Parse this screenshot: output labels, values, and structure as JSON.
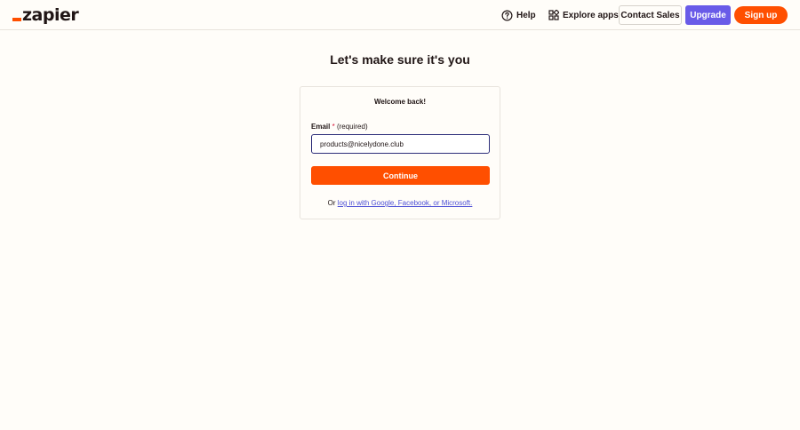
{
  "header": {
    "logo_text": "zapier",
    "help_label": "Help",
    "explore_label": "Explore apps",
    "contact_label": "Contact Sales",
    "upgrade_label": "Upgrade",
    "signup_label": "Sign up"
  },
  "main": {
    "title": "Let's make sure it's you",
    "card": {
      "welcome": "Welcome back!",
      "email_label": "Email",
      "required_star": "*",
      "required_text": "(required)",
      "email_value": "products@nicelydone.club",
      "continue_label": "Continue",
      "alt_prefix": "Or",
      "alt_link": "log in with Google, Facebook, or Microsoft."
    }
  },
  "colors": {
    "brand_orange": "#ff4f00",
    "upgrade_purple": "#695be8",
    "background": "#fffdf9",
    "link": "#4d4fd6"
  },
  "icons": {
    "help": "help-circle-icon",
    "explore": "apps-grid-icon"
  }
}
